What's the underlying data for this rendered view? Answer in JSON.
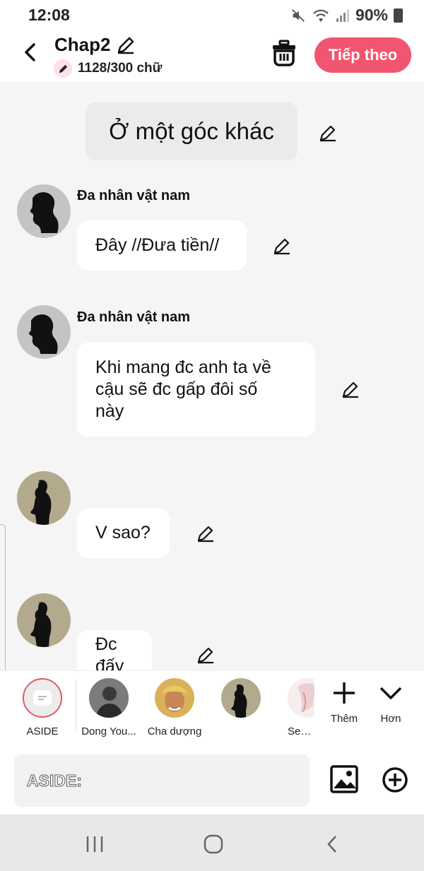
{
  "status": {
    "time": "12:08",
    "battery": "90%"
  },
  "header": {
    "title": "Chap2",
    "word_count": "1128/300 chữ",
    "next_label": "Tiếp theo"
  },
  "messages": {
    "scene": "Ở một góc khác",
    "m1_speaker": "Đa nhân vật nam",
    "m1_text": "Đây //Đưa tiền//",
    "m2_speaker": "Đa nhân vật nam",
    "m2_line1": "Khi mang đc anh ta về",
    "m2_line2": "cậu sẽ đc gấp đôi số",
    "m2_line3": "này",
    "m3_text": "V sao?",
    "m4_text": "Đc đấy"
  },
  "characters": [
    {
      "name": "ASIDE"
    },
    {
      "name": "Dong You..."
    },
    {
      "name": "Cha dượng"
    },
    {
      "name": ""
    },
    {
      "name": "Seo ..."
    }
  ],
  "strip_buttons": {
    "more": "Thêm",
    "expand": "Hơn"
  },
  "input": {
    "placeholder": "ASIDE:"
  },
  "colors": {
    "accent": "#f2556f",
    "aside_ring": "#e05a6a"
  }
}
